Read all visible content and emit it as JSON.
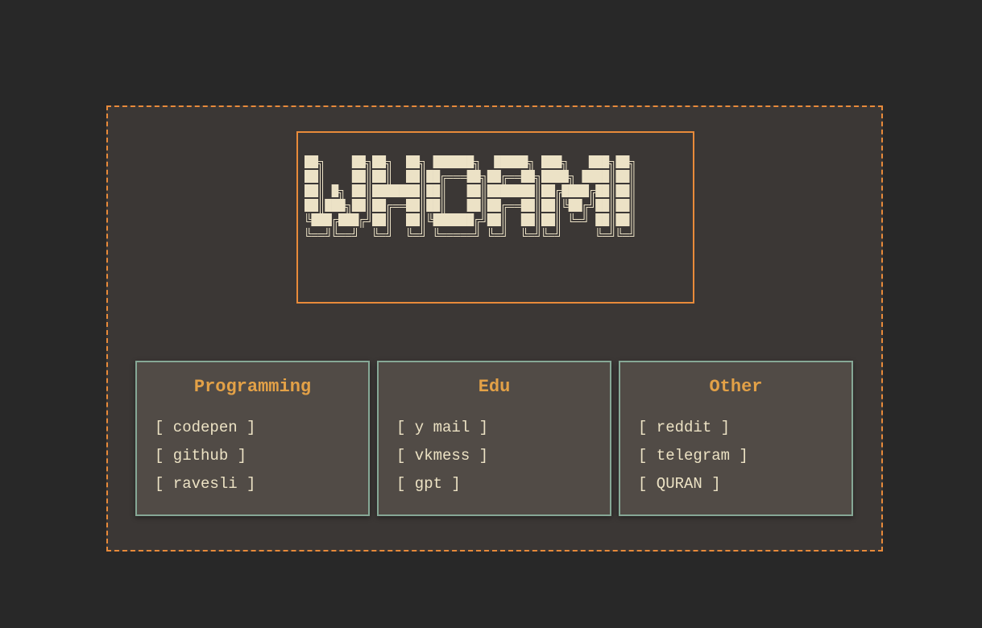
{
  "banner": {
    "word": "WHOAMI",
    "colors": {
      "fill": "#ece2c6",
      "outline": "#ece2c6",
      "border": "#e88a3a"
    }
  },
  "colors": {
    "page_bg": "#282828",
    "panel_bg": "#3b3735",
    "card_bg": "#514b46",
    "card_border": "#86a896",
    "heading": "#e3a147",
    "link_text": "#ece2c4",
    "accent": "#e88a3a"
  },
  "sections": [
    {
      "title": "Programming",
      "links": [
        "[ codepen ]",
        "[ github ]",
        "[ ravesli ]"
      ]
    },
    {
      "title": "Edu",
      "links": [
        "[ y mail ]",
        "[ vkmess ]",
        "[ gpt ]"
      ]
    },
    {
      "title": "Other",
      "links": [
        "[ reddit ]",
        "[ telegram ]",
        "[ QURAN ]"
      ]
    }
  ]
}
